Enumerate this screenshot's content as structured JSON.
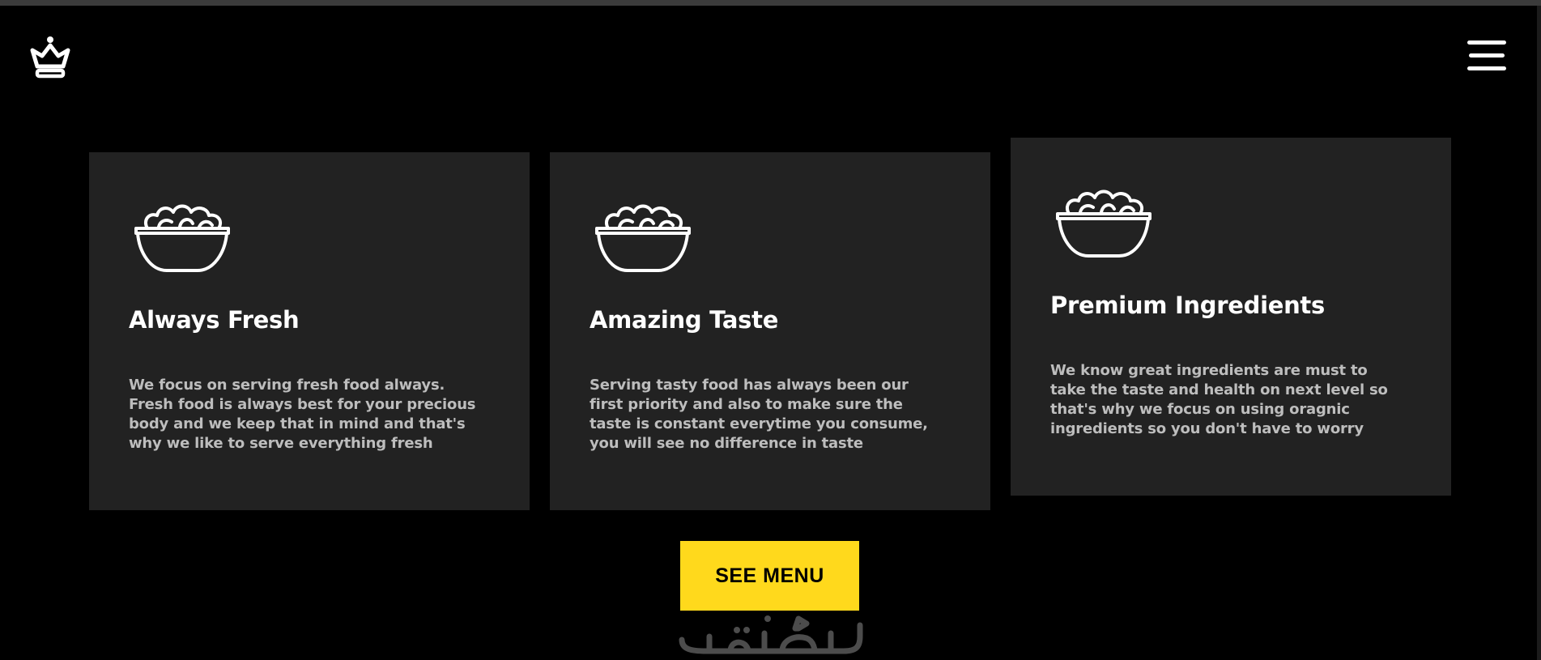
{
  "header": {
    "logo_icon": "crown-chef-icon",
    "menu_icon": "hamburger-menu-icon"
  },
  "features": [
    {
      "icon": "salad-bowl-icon",
      "title": "Always Fresh",
      "text": "We focus on serving fresh food always. Fresh food is always best for your precious body and we keep that in mind and that's why we like to serve everything fresh"
    },
    {
      "icon": "salad-bowl-icon",
      "title": "Amazing Taste",
      "text": "Serving tasty food has always been our first priority and also to make sure the taste is constant everytime you consume, you will see no difference in taste"
    },
    {
      "icon": "salad-bowl-icon",
      "title": "Premium Ingredients",
      "text": "We know great ingredients are must to take the taste and health on next level so that's why we focus on using oragnic ingredients so you don't have to worry"
    }
  ],
  "cta": {
    "label": "SEE MENU"
  },
  "watermark": {
    "icon": "khamsat-watermark-icon"
  },
  "colors": {
    "background": "#000000",
    "card": "#222222",
    "accent": "#ffd91c",
    "body_text": "#bdbdbd"
  }
}
